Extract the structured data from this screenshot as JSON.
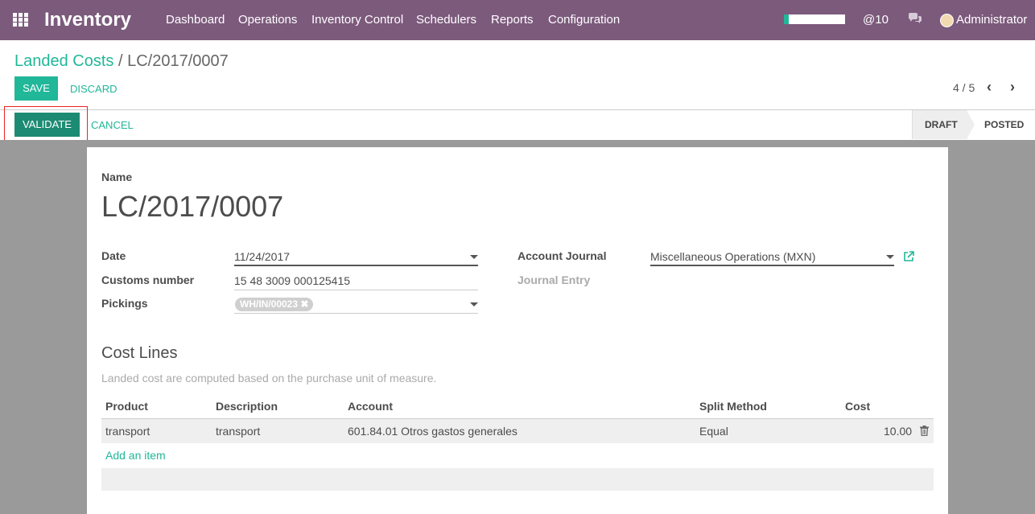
{
  "navbar": {
    "app_title": "Inventory",
    "menu": [
      "Dashboard",
      "Operations",
      "Inventory Control",
      "Schedulers",
      "Reports",
      "Configuration"
    ],
    "progress_fraction": 0.08,
    "mentions": "@10",
    "user": "Administrator"
  },
  "breadcrumb": {
    "parent": "Landed Costs",
    "separator": "/",
    "current": "LC/2017/0007"
  },
  "actions": {
    "save": "SAVE",
    "discard": "DISCARD"
  },
  "pager": {
    "value": "4 / 5"
  },
  "status": {
    "validate": "VALIDATE",
    "cancel": "CANCEL",
    "stages": [
      "DRAFT",
      "POSTED"
    ],
    "active_stage": "DRAFT"
  },
  "form": {
    "name_label": "Name",
    "name_value": "LC/2017/0007",
    "date_label": "Date",
    "date_value": "11/24/2017",
    "customs_label": "Customs number",
    "customs_value": "15 48 3009 000125415",
    "pickings_label": "Pickings",
    "pickings_tag": "WH/IN/00023",
    "journal_label": "Account Journal",
    "journal_value": "Miscellaneous Operations (MXN)",
    "journal_entry_label": "Journal Entry"
  },
  "cost_lines": {
    "title": "Cost Lines",
    "hint": "Landed cost are computed based on the purchase unit of measure.",
    "headers": [
      "Product",
      "Description",
      "Account",
      "Split Method",
      "Cost"
    ],
    "rows": [
      [
        "transport",
        "transport",
        "601.84.01 Otros gastos generales",
        "Equal",
        "10.00"
      ]
    ],
    "add_item": "Add an item"
  },
  "colors": {
    "navbar": "#7c5a7c",
    "accent": "#21b799",
    "validate": "#1d8b74"
  }
}
